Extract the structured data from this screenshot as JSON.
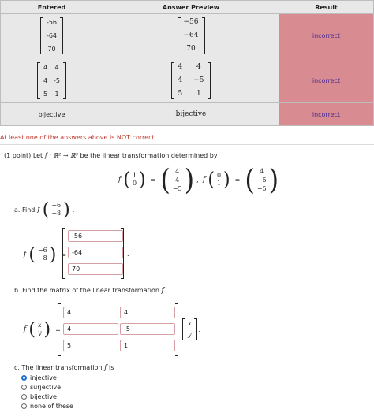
{
  "table": {
    "headers": [
      "Entered",
      "Answer Preview",
      "Result"
    ],
    "rows": [
      {
        "entered": [
          "-56",
          "-64",
          "70"
        ],
        "preview": [
          "−56",
          "−64",
          "70"
        ],
        "result": "incorrect"
      },
      {
        "entered": [
          [
            "4",
            "4"
          ],
          [
            "4",
            "-5"
          ],
          [
            "5",
            "1"
          ]
        ],
        "preview": [
          [
            "4",
            "4"
          ],
          [
            "4",
            "−5"
          ],
          [
            "5",
            "1"
          ]
        ],
        "result": "incorrect"
      },
      {
        "entered": "bijective",
        "preview": "bijective",
        "result": "incorrect"
      }
    ]
  },
  "message": "At least one of the answers above is NOT correct.",
  "problem": {
    "intro_prefix": "(1 point) Let",
    "intro_suffix": "be the linear transformation determined by",
    "mapping": "f : ℝ² → ℝ³",
    "def1_input": [
      "1",
      "0"
    ],
    "def1_output": [
      "4",
      "4",
      "−5"
    ],
    "def2_input": [
      "0",
      "1"
    ],
    "def2_output": [
      "4",
      "−5",
      "−5"
    ],
    "part_a": {
      "label": "a. Find",
      "vector": [
        "−6",
        "−8"
      ],
      "answers": [
        "-56",
        "-64",
        "70"
      ]
    },
    "part_b": {
      "label": "b. Find the matrix of the linear transformation",
      "vars": [
        "x",
        "y"
      ],
      "answers": [
        [
          "4",
          "4"
        ],
        [
          "4",
          "-5"
        ],
        [
          "5",
          "1"
        ]
      ]
    },
    "part_c": {
      "label": "c. The linear transformation",
      "label_suffix": "is",
      "options": [
        "injective",
        "surjective",
        "bijective",
        "none of these"
      ],
      "selected": "injective"
    }
  }
}
